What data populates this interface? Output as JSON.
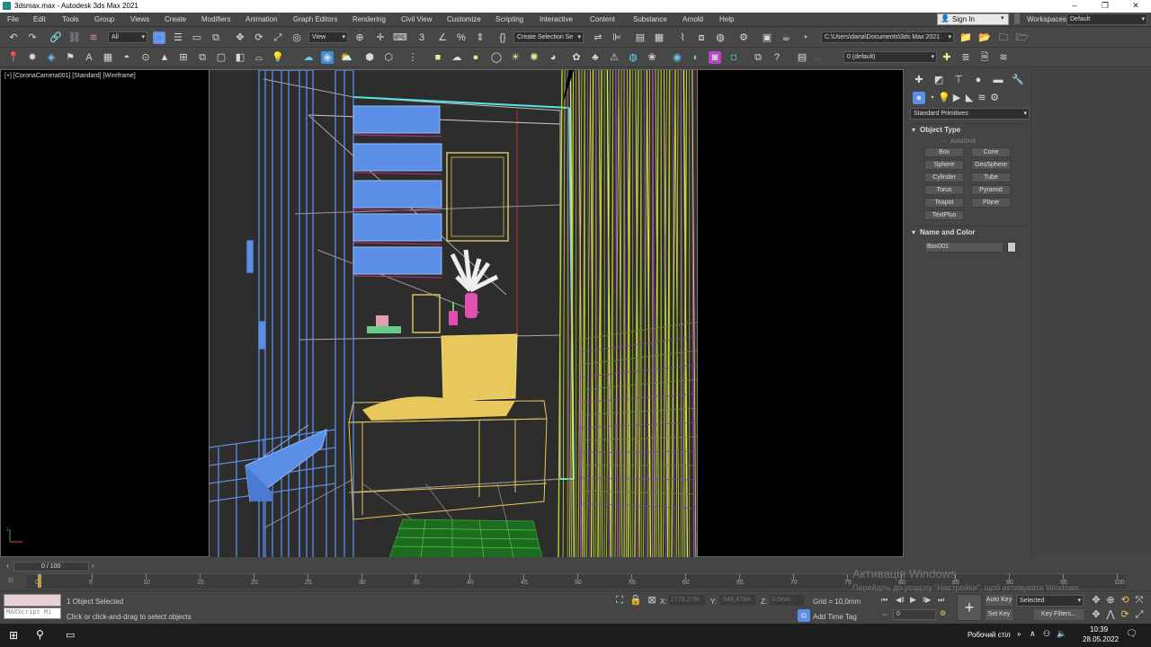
{
  "titlebar": {
    "title": "3dsmax.max - Autodesk 3ds Max 2021",
    "minimize": "–",
    "restore": "❐",
    "close": "✕"
  },
  "menu": [
    "File",
    "Edit",
    "Tools",
    "Group",
    "Views",
    "Create",
    "Modifiers",
    "Animation",
    "Graph Editors",
    "Rendering",
    "Civil View",
    "Customize",
    "Scripting",
    "Interactive",
    "Content",
    "Substance",
    "Arnold",
    "Help"
  ],
  "account": {
    "signin": "Sign In",
    "workspaces_label": "Workspaces:",
    "workspace": "Default"
  },
  "toolbar": {
    "filter": "All",
    "refcoord": "View",
    "selection_set": "Create Selection Se",
    "project_path": "C:\\Users\\daria\\Documents\\3ds Max 2021",
    "layer": "0 (default)"
  },
  "viewport": {
    "label": "[+] [CoronaCamera001] [Standard] [Wireframe]"
  },
  "command_panel": {
    "category": "Standard Primitives",
    "object_type_title": "Object Type",
    "autogrid": "AutoGrid",
    "buttons": [
      "Box",
      "Cone",
      "Sphere",
      "GeoSphere",
      "Cylinder",
      "Tube",
      "Torus",
      "Pyramid",
      "Teapot",
      "Plane",
      "TextPlus"
    ],
    "name_color_title": "Name and Color",
    "object_name": "Box001",
    "object_color": "#c8c8c8"
  },
  "timeline": {
    "frame_readout": "0 / 100",
    "ticks": [
      "0",
      "5",
      "10",
      "15",
      "20",
      "25",
      "30",
      "35",
      "40",
      "45",
      "50",
      "55",
      "60",
      "65",
      "70",
      "75",
      "80",
      "85",
      "90",
      "95",
      "100"
    ]
  },
  "status": {
    "script_placeholder": "MAXScript Mi",
    "selected": "1 Object Selected",
    "prompt": "Click or click-and-drag to select objects",
    "x_label": "X:",
    "x": "2778,275r",
    "y_label": "Y:",
    "y": "-546,473m",
    "z_label": "Z:",
    "z": "0,0mm",
    "grid": "Grid = 10,0mm",
    "add_time_tag": "Add Time Tag",
    "frame": "0",
    "auto_key": "Auto Key",
    "set_key": "Set Key",
    "key_mode": "Selected",
    "key_filters": "Key Filters..."
  },
  "watermark": {
    "line1": "Активація Windows",
    "line2": "Перейдіть до розділу \"Настройки\", щоб активувати Windows."
  },
  "taskbar": {
    "desktop": "Робочий стіл",
    "time": "10:39",
    "date": "28.05.2022"
  },
  "colors": {
    "accent_blue": "#5b8ee6",
    "wire_yellow": "#e8c85a",
    "curtain_green": "#b5d22a",
    "cyan": "#5ce1e6"
  }
}
